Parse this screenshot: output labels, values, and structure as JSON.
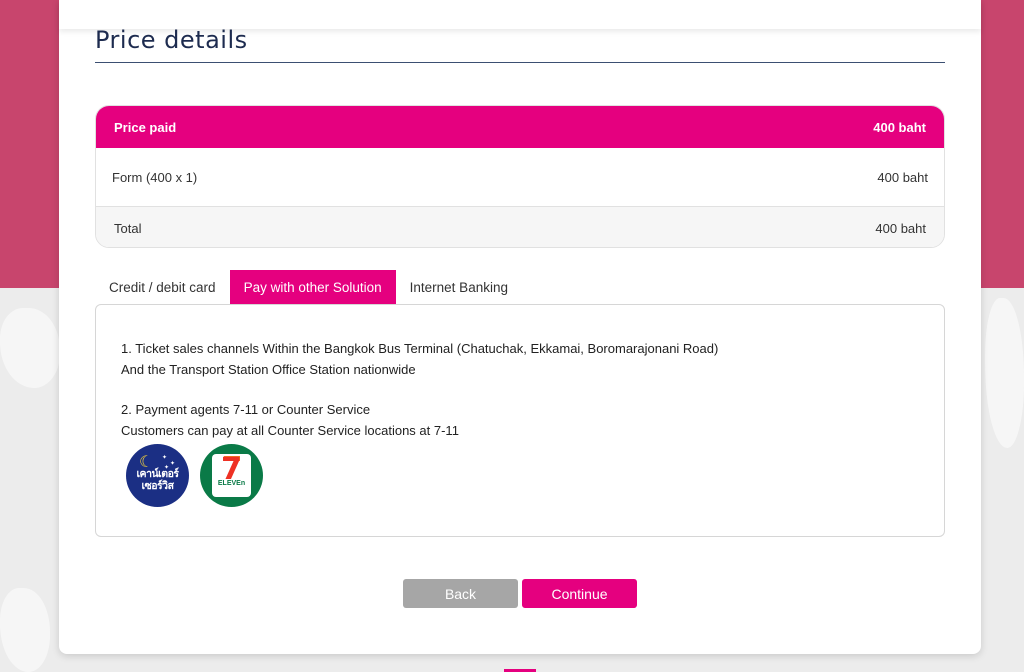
{
  "page": {
    "title": "Price details"
  },
  "price_table": {
    "header": {
      "label": "Price paid",
      "value": "400 baht"
    },
    "rows": [
      {
        "label": "Form (400 x 1)",
        "value": "400 baht"
      }
    ],
    "total": {
      "label": "Total",
      "value": "400 baht"
    }
  },
  "tabs": [
    {
      "label": "Credit / debit card",
      "active": false
    },
    {
      "label": "Pay with other Solution",
      "active": true
    },
    {
      "label": "Internet Banking",
      "active": false
    }
  ],
  "panel": {
    "line1": "1. Ticket sales channels Within the Bangkok Bus Terminal (Chatuchak, Ekkamai, Boromarajonani Road)",
    "line2": "And the Transport Station Office Station nationwide",
    "line3": "2. Payment agents 7-11 or Counter Service",
    "line4": "Customers can pay at all Counter Service locations at 7-11",
    "logos": {
      "counter_service_line1": "เคาน์เตอร์",
      "counter_service_line2": "เซอร์วิส",
      "seven_eleven_number": "7",
      "seven_eleven_text": "ELEVEn"
    }
  },
  "buttons": {
    "back": "Back",
    "continue": "Continue"
  },
  "colors": {
    "accent": "#e5007f",
    "background_top": "#c8456d",
    "button_back": "#a6a6a6"
  }
}
